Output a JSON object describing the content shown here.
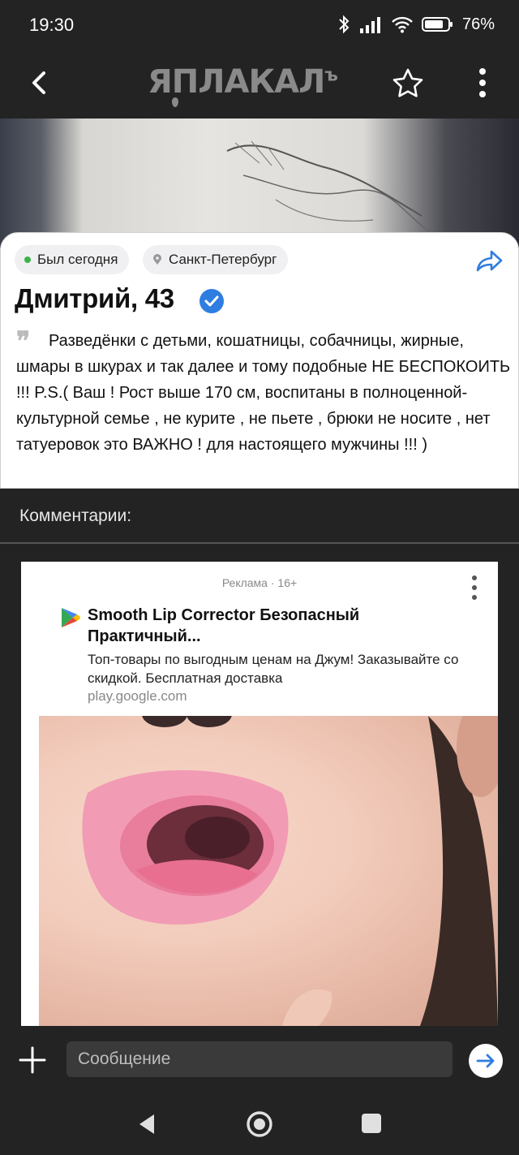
{
  "status_bar": {
    "time": "19:30",
    "battery": "76%"
  },
  "app_header": {
    "logo_text": "ЯПЛАКАЛ",
    "logo_suffix": "ъ"
  },
  "post": {
    "chip_status": "Был сегодня",
    "chip_city": "Санкт-Петербург",
    "name": "Дмитрий, 43",
    "bio": "Разведёнки с детьми, кошатницы, собачницы, жирные, шмары в шкурах и так далее и тому подобные НЕ БЕСПОКОИТЬ !!! P.S.( Ваш ! Рост выше 170 см, воспитаны в полноценной-культурной семье , не курите , не пьете , брюки не носите , нет татуеровок это ВАЖНО ! для настоящего мужчины !!! )"
  },
  "comments": {
    "title": "Комментарии:"
  },
  "ad": {
    "label": "Реклама · 16+",
    "title": "Smooth Lip Corrector Безопасный Практичный...",
    "description": "Топ-товары по выгодным ценам на Джум! Заказывайте со скидкой. Бесплатная доставка",
    "url": "play.google.com"
  },
  "message_bar": {
    "placeholder": "Сообщение"
  },
  "colors": {
    "background": "#232323",
    "accent_blue": "#2f7de1",
    "online_green": "#3cb34a"
  }
}
